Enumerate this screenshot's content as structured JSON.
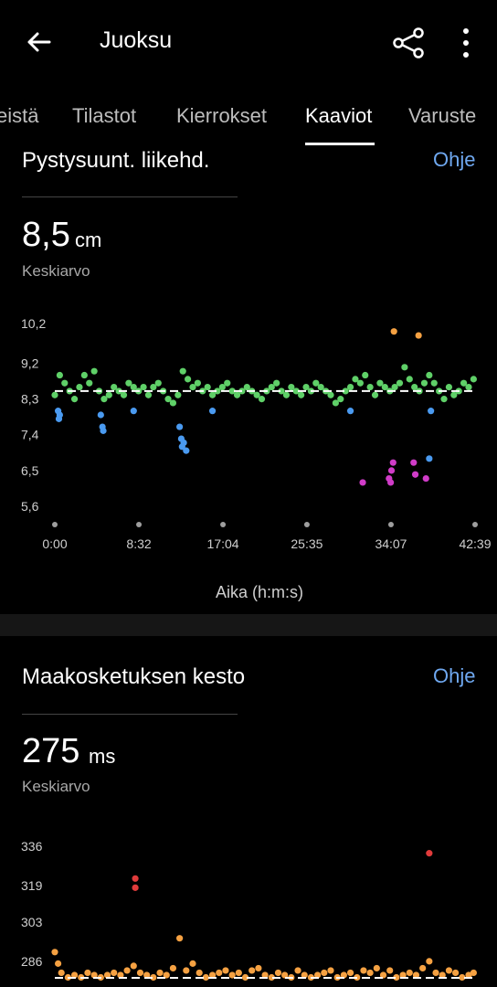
{
  "appbar": {
    "title": "Juoksu",
    "back_icon": "arrow-left-icon",
    "share_icon": "share-icon",
    "menu_icon": "more-vertical-icon"
  },
  "tabs": [
    {
      "label": "eistä",
      "active": false
    },
    {
      "label": "Tilastot",
      "active": false
    },
    {
      "label": "Kierrokset",
      "active": false
    },
    {
      "label": "Kaaviot",
      "active": true
    },
    {
      "label": "Varuste",
      "active": false
    }
  ],
  "vertical_oscillation": {
    "title": "Pystysuunt. liikehd.",
    "help": "Ohje",
    "value": "8,5",
    "unit": "cm",
    "value_caption": "Keskiarvo",
    "x_axis_label": "Aika (h:m:s)"
  },
  "ground_contact": {
    "title": "Maakosketuksen kesto",
    "help": "Ohje",
    "value": "275",
    "unit": "ms",
    "value_caption": "Keskiarvo"
  },
  "colors": {
    "green": "#5fd068",
    "blue": "#4a9af0",
    "orange": "#f5a142",
    "red": "#e03b3b",
    "purple": "#d03cc8",
    "link": "#6fa8f0"
  },
  "chart_data": [
    {
      "type": "scatter",
      "title": "Pystysuunt. liikehd.",
      "xlabel": "Aika (h:m:s)",
      "ylabel": "",
      "y_tick_labels": [
        "10,2",
        "9,2",
        "8,3",
        "7,4",
        "6,5",
        "5,6"
      ],
      "y_ticks": [
        10.2,
        9.2,
        8.3,
        7.4,
        6.5,
        5.6
      ],
      "x_tick_labels": [
        "0:00",
        "8:32",
        "17:04",
        "25:35",
        "34:07",
        "42:39"
      ],
      "x_ticks": [
        0,
        512,
        1024,
        1535,
        2047,
        2559
      ],
      "ylim": [
        5.6,
        10.2
      ],
      "xlim": [
        0,
        2559
      ],
      "average_line": 8.5,
      "grid": false,
      "series": [
        {
          "color": "#5fd068",
          "x": [
            0,
            30,
            60,
            90,
            120,
            150,
            180,
            210,
            240,
            270,
            300,
            330,
            360,
            390,
            420,
            450,
            480,
            510,
            540,
            570,
            600,
            630,
            660,
            690,
            720,
            750,
            780,
            810,
            840,
            870,
            900,
            930,
            960,
            990,
            1020,
            1050,
            1080,
            1110,
            1140,
            1170,
            1200,
            1230,
            1260,
            1290,
            1320,
            1350,
            1380,
            1410,
            1440,
            1470,
            1500,
            1530,
            1560,
            1590,
            1620,
            1650,
            1680,
            1710,
            1740,
            1770,
            1800,
            1830,
            1860,
            1890,
            1920,
            1950,
            1980,
            2010,
            2040,
            2070,
            2100,
            2130,
            2160,
            2190,
            2220,
            2250,
            2280,
            2310,
            2340,
            2370,
            2400,
            2430,
            2460,
            2490,
            2520,
            2550
          ],
          "y": [
            8.4,
            8.9,
            8.7,
            8.5,
            8.3,
            8.6,
            8.9,
            8.7,
            9.0,
            8.5,
            8.3,
            8.4,
            8.6,
            8.5,
            8.4,
            8.7,
            8.6,
            8.5,
            8.6,
            8.4,
            8.6,
            8.7,
            8.5,
            8.3,
            8.2,
            8.4,
            9.0,
            8.8,
            8.6,
            8.7,
            8.5,
            8.6,
            8.4,
            8.5,
            8.6,
            8.7,
            8.5,
            8.4,
            8.5,
            8.6,
            8.5,
            8.4,
            8.3,
            8.5,
            8.6,
            8.7,
            8.5,
            8.4,
            8.6,
            8.5,
            8.4,
            8.6,
            8.5,
            8.7,
            8.6,
            8.5,
            8.4,
            8.2,
            8.3,
            8.5,
            8.6,
            8.8,
            8.7,
            8.9,
            8.6,
            8.4,
            8.7,
            8.6,
            8.5,
            8.6,
            8.7,
            9.1,
            8.8,
            8.6,
            8.5,
            8.7,
            8.9,
            8.7,
            8.5,
            8.3,
            8.6,
            8.4,
            8.5,
            8.7,
            8.6,
            8.8
          ]
        },
        {
          "color": "#4a9af0",
          "x": [
            20,
            25,
            30,
            280,
            290,
            295,
            480,
            760,
            770,
            775,
            785,
            800,
            960,
            1800,
            2290,
            2280
          ],
          "y": [
            8.0,
            7.8,
            7.9,
            7.9,
            7.6,
            7.5,
            8.0,
            7.6,
            7.3,
            7.1,
            7.2,
            7.0,
            8.0,
            8.0,
            8.0,
            6.8
          ]
        },
        {
          "color": "#f5a142",
          "x": [
            2065,
            2215
          ],
          "y": [
            10.0,
            9.9
          ]
        },
        {
          "color": "#d03cc8",
          "x": [
            1875,
            2035,
            2045,
            2050,
            2060,
            2185,
            2195,
            2260
          ],
          "y": [
            6.2,
            6.3,
            6.2,
            6.5,
            6.7,
            6.7,
            6.4,
            6.3
          ]
        }
      ]
    },
    {
      "type": "scatter",
      "title": "Maakosketuksen kesto",
      "y_tick_labels": [
        "336",
        "319",
        "303",
        "286"
      ],
      "y_ticks": [
        336,
        319,
        303,
        286
      ],
      "ylim": [
        278,
        340
      ],
      "xlim": [
        0,
        2559
      ],
      "average_line": 275,
      "grid": false,
      "series": [
        {
          "color": "#f5a142",
          "x": [
            0,
            20,
            40,
            80,
            120,
            160,
            200,
            240,
            280,
            320,
            360,
            400,
            440,
            480,
            520,
            560,
            600,
            640,
            680,
            720,
            760,
            800,
            840,
            880,
            920,
            960,
            1000,
            1040,
            1080,
            1120,
            1160,
            1200,
            1240,
            1280,
            1320,
            1360,
            1400,
            1440,
            1480,
            1520,
            1560,
            1600,
            1640,
            1680,
            1720,
            1760,
            1800,
            1840,
            1880,
            1920,
            1960,
            2000,
            2040,
            2080,
            2120,
            2160,
            2200,
            2240,
            2280,
            2320,
            2360,
            2400,
            2440,
            2480,
            2520,
            2550
          ],
          "y": [
            290,
            285,
            281,
            279,
            280,
            279,
            281,
            280,
            279,
            280,
            281,
            280,
            282,
            284,
            281,
            280,
            279,
            281,
            280,
            283,
            296,
            282,
            285,
            281,
            279,
            280,
            281,
            282,
            280,
            281,
            279,
            282,
            283,
            280,
            279,
            281,
            280,
            279,
            282,
            280,
            279,
            280,
            281,
            282,
            279,
            280,
            281,
            279,
            282,
            281,
            283,
            280,
            282,
            279,
            280,
            281,
            280,
            283,
            286,
            281,
            280,
            282,
            281,
            279,
            280,
            281
          ]
        },
        {
          "color": "#e03b3b",
          "x": [
            490,
            490,
            2280
          ],
          "y": [
            322,
            318,
            333
          ]
        }
      ]
    }
  ]
}
